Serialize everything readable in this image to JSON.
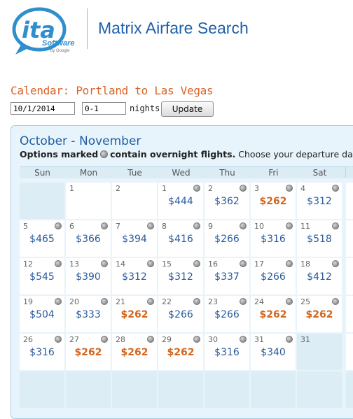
{
  "header": {
    "logo_text": "ita",
    "logo_sub": "Software",
    "logo_byline": "by Google",
    "app_title": "Matrix Airfare Search"
  },
  "search": {
    "title": "Calendar: Portland to Las Vegas",
    "date_value": "10/1/2014",
    "nights_value": "0-1",
    "nights_label": "nights",
    "update_label": "Update"
  },
  "calendar": {
    "month_title": "October - November",
    "options_bold_1": "Options marked",
    "options_bold_2": "contain overnight flights.",
    "options_rest": "Choose your departure date.",
    "weekdays": [
      "Sun",
      "Mon",
      "Tue",
      "Wed",
      "Thu",
      "Fri",
      "Sat"
    ],
    "lowest_price_color": "#d2661e",
    "price_color": "#2a5b9c",
    "weeks": [
      [
        {
          "day": "",
          "price": "",
          "overnight": false,
          "lowest": false,
          "empty": true
        },
        {
          "day": "1",
          "price": "",
          "overnight": false,
          "lowest": false,
          "empty": false
        },
        {
          "day": "2",
          "price": "",
          "overnight": false,
          "lowest": false,
          "empty": false
        },
        {
          "day": "1",
          "price": "$444",
          "overnight": true,
          "lowest": false,
          "empty": false
        },
        {
          "day": "2",
          "price": "$362",
          "overnight": true,
          "lowest": false,
          "empty": false
        },
        {
          "day": "3",
          "price": "$262",
          "overnight": true,
          "lowest": true,
          "empty": false
        },
        {
          "day": "4",
          "price": "$312",
          "overnight": true,
          "lowest": false,
          "empty": false
        }
      ],
      [
        {
          "day": "5",
          "price": "$465",
          "overnight": true,
          "lowest": false,
          "empty": false
        },
        {
          "day": "6",
          "price": "$366",
          "overnight": true,
          "lowest": false,
          "empty": false
        },
        {
          "day": "7",
          "price": "$394",
          "overnight": true,
          "lowest": false,
          "empty": false
        },
        {
          "day": "8",
          "price": "$416",
          "overnight": true,
          "lowest": false,
          "empty": false
        },
        {
          "day": "9",
          "price": "$266",
          "overnight": true,
          "lowest": false,
          "empty": false
        },
        {
          "day": "10",
          "price": "$316",
          "overnight": true,
          "lowest": false,
          "empty": false
        },
        {
          "day": "11",
          "price": "$518",
          "overnight": true,
          "lowest": false,
          "empty": false
        }
      ],
      [
        {
          "day": "12",
          "price": "$545",
          "overnight": true,
          "lowest": false,
          "empty": false
        },
        {
          "day": "13",
          "price": "$390",
          "overnight": true,
          "lowest": false,
          "empty": false
        },
        {
          "day": "14",
          "price": "$312",
          "overnight": true,
          "lowest": false,
          "empty": false
        },
        {
          "day": "15",
          "price": "$312",
          "overnight": true,
          "lowest": false,
          "empty": false
        },
        {
          "day": "16",
          "price": "$337",
          "overnight": true,
          "lowest": false,
          "empty": false
        },
        {
          "day": "17",
          "price": "$266",
          "overnight": true,
          "lowest": false,
          "empty": false
        },
        {
          "day": "18",
          "price": "$412",
          "overnight": true,
          "lowest": false,
          "empty": false
        }
      ],
      [
        {
          "day": "19",
          "price": "$504",
          "overnight": true,
          "lowest": false,
          "empty": false
        },
        {
          "day": "20",
          "price": "$333",
          "overnight": true,
          "lowest": false,
          "empty": false
        },
        {
          "day": "21",
          "price": "$262",
          "overnight": true,
          "lowest": true,
          "empty": false
        },
        {
          "day": "22",
          "price": "$266",
          "overnight": true,
          "lowest": false,
          "empty": false
        },
        {
          "day": "23",
          "price": "$266",
          "overnight": true,
          "lowest": false,
          "empty": false
        },
        {
          "day": "24",
          "price": "$262",
          "overnight": true,
          "lowest": true,
          "empty": false
        },
        {
          "day": "25",
          "price": "$262",
          "overnight": true,
          "lowest": true,
          "empty": false
        }
      ],
      [
        {
          "day": "26",
          "price": "$316",
          "overnight": true,
          "lowest": false,
          "empty": false
        },
        {
          "day": "27",
          "price": "$262",
          "overnight": true,
          "lowest": true,
          "empty": false
        },
        {
          "day": "28",
          "price": "$262",
          "overnight": true,
          "lowest": true,
          "empty": false
        },
        {
          "day": "29",
          "price": "$262",
          "overnight": true,
          "lowest": true,
          "empty": false
        },
        {
          "day": "30",
          "price": "$316",
          "overnight": true,
          "lowest": false,
          "empty": false
        },
        {
          "day": "31",
          "price": "$340",
          "overnight": true,
          "lowest": false,
          "empty": false
        },
        {
          "day": "31",
          "price": "",
          "overnight": false,
          "lowest": false,
          "empty": true
        }
      ],
      [
        {
          "day": "",
          "price": "",
          "overnight": false,
          "lowest": false,
          "empty": true
        },
        {
          "day": "",
          "price": "",
          "overnight": false,
          "lowest": false,
          "empty": true
        },
        {
          "day": "",
          "price": "",
          "overnight": false,
          "lowest": false,
          "empty": true
        },
        {
          "day": "",
          "price": "",
          "overnight": false,
          "lowest": false,
          "empty": true
        },
        {
          "day": "",
          "price": "",
          "overnight": false,
          "lowest": false,
          "empty": true
        },
        {
          "day": "",
          "price": "",
          "overnight": false,
          "lowest": false,
          "empty": true
        },
        {
          "day": "",
          "price": "",
          "overnight": false,
          "lowest": false,
          "empty": true
        }
      ]
    ]
  }
}
